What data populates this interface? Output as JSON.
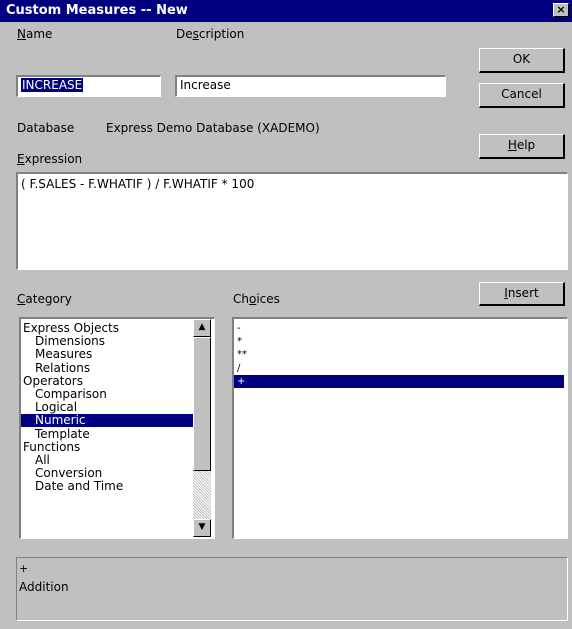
{
  "window": {
    "title": "Custom Measures -- New",
    "close_glyph": "×"
  },
  "name": {
    "label_accel": "N",
    "label_rest": "ame",
    "value": "INCREASE"
  },
  "description": {
    "label_pre": "De",
    "label_accel": "s",
    "label_rest": "cription",
    "value": "Increase"
  },
  "buttons": {
    "ok": "OK",
    "cancel": "Cancel",
    "help_accel": "H",
    "help_rest": "elp",
    "insert_accel": "I",
    "insert_rest": "nsert"
  },
  "database": {
    "label": "Database",
    "value": "Express Demo Database (XADEMO)"
  },
  "expression": {
    "label_accel": "E",
    "label_rest": "xpression",
    "value": "( F.SALES - F.WHATIF ) / F.WHATIF * 100"
  },
  "category": {
    "label_accel": "C",
    "label_rest": "ategory",
    "items": [
      {
        "label": "Express Objects",
        "indent": false,
        "selected": false
      },
      {
        "label": "Dimensions",
        "indent": true,
        "selected": false
      },
      {
        "label": "Measures",
        "indent": true,
        "selected": false
      },
      {
        "label": "Relations",
        "indent": true,
        "selected": false
      },
      {
        "label": "Operators",
        "indent": false,
        "selected": false
      },
      {
        "label": "Comparison",
        "indent": true,
        "selected": false
      },
      {
        "label": "Logical",
        "indent": true,
        "selected": false
      },
      {
        "label": "Numeric",
        "indent": true,
        "selected": true
      },
      {
        "label": "Template",
        "indent": true,
        "selected": false
      },
      {
        "label": "Functions",
        "indent": false,
        "selected": false
      },
      {
        "label": "All",
        "indent": true,
        "selected": false
      },
      {
        "label": "Conversion",
        "indent": true,
        "selected": false
      },
      {
        "label": "Date and Time",
        "indent": true,
        "selected": false
      }
    ]
  },
  "choices": {
    "label_pre": "Ch",
    "label_accel": "o",
    "label_rest": "ices",
    "items": [
      {
        "label": "-",
        "selected": false
      },
      {
        "label": "*",
        "selected": false
      },
      {
        "label": "**",
        "selected": false
      },
      {
        "label": "/",
        "selected": false
      },
      {
        "label": "+",
        "selected": true
      }
    ]
  },
  "description_panel": {
    "symbol": "+",
    "text": "Addition"
  },
  "colors": {
    "title_bar": "#000080",
    "face": "#c0c0c0",
    "selection": "#000080"
  },
  "icons": {
    "scroll_up": "scroll-up-arrow-icon",
    "scroll_down": "scroll-down-arrow-icon",
    "close": "close-icon"
  }
}
